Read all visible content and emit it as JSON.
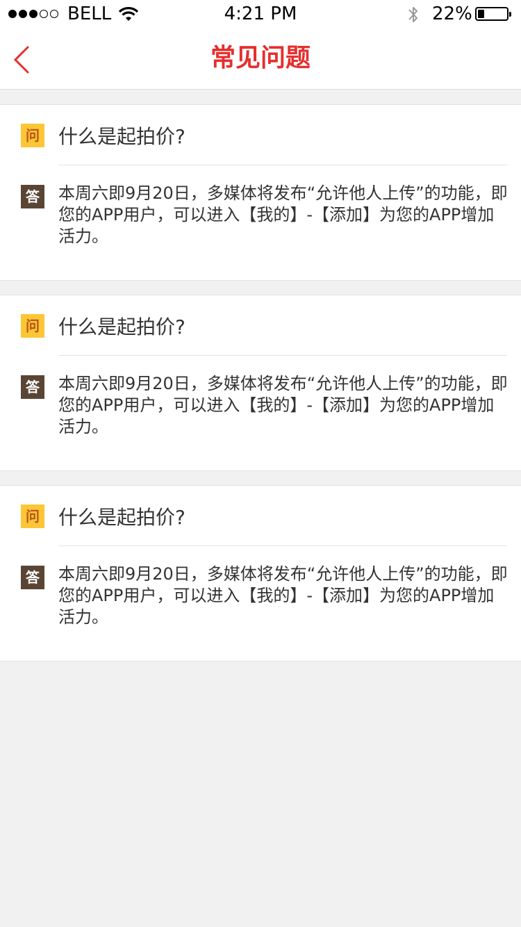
{
  "status_bar": {
    "carrier": "BELL",
    "time": "4:21 PM",
    "battery_percent": "22%",
    "battery_level": 0.22,
    "signal_filled": 3,
    "signal_total": 5,
    "icons": [
      "wifi-icon",
      "bluetooth-icon",
      "battery-icon"
    ]
  },
  "nav": {
    "title": "常见问题",
    "back_icon": "chevron-left-icon",
    "accent_color": "#e62e2e"
  },
  "faq": {
    "question_badge": "问",
    "answer_badge": "答",
    "question_badge_color": "#fcc636",
    "answer_badge_color": "#5a4535",
    "items": [
      {
        "question": "什么是起拍价?",
        "answer": "本周六即9月20日，多媒体将发布“允许他人上传”的功能，即您的APP用户，可以进入【我的】-【添加】为您的APP增加活力。"
      },
      {
        "question": "什么是起拍价?",
        "answer": "本周六即9月20日，多媒体将发布“允许他人上传”的功能，即您的APP用户，可以进入【我的】-【添加】为您的APP增加活力。"
      },
      {
        "question": "什么是起拍价?",
        "answer": "本周六即9月20日，多媒体将发布“允许他人上传”的功能，即您的APP用户，可以进入【我的】-【添加】为您的APP增加活力。"
      }
    ]
  }
}
